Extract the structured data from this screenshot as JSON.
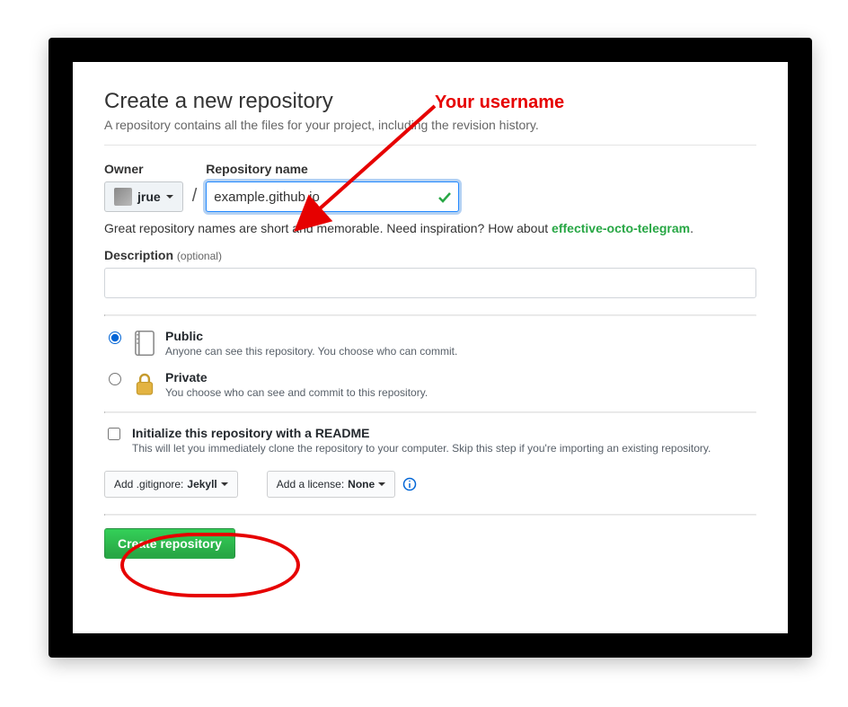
{
  "heading": {
    "title": "Create a new repository",
    "subtitle": "A repository contains all the files for your project, including the revision history."
  },
  "owner": {
    "label": "Owner",
    "name": "jrue"
  },
  "repo": {
    "label": "Repository name",
    "value": "example.github.io"
  },
  "hint": {
    "prefix": "Great repository names are short and memorable. Need inspiration? How about ",
    "suggestion": "effective-octo-telegram",
    "suffix": "."
  },
  "description": {
    "label": "Description",
    "optional": "(optional)",
    "value": ""
  },
  "visibility": {
    "public": {
      "title": "Public",
      "desc": "Anyone can see this repository. You choose who can commit."
    },
    "private": {
      "title": "Private",
      "desc": "You choose who can see and commit to this repository."
    }
  },
  "init": {
    "title": "Initialize this repository with a README",
    "desc": "This will let you immediately clone the repository to your computer. Skip this step if you're importing an existing repository."
  },
  "gitignore": {
    "prefix": "Add .gitignore: ",
    "value": "Jekyll"
  },
  "license": {
    "prefix": "Add a license: ",
    "value": "None"
  },
  "create_label": "Create repository",
  "annotation": {
    "username_label": "Your username"
  }
}
